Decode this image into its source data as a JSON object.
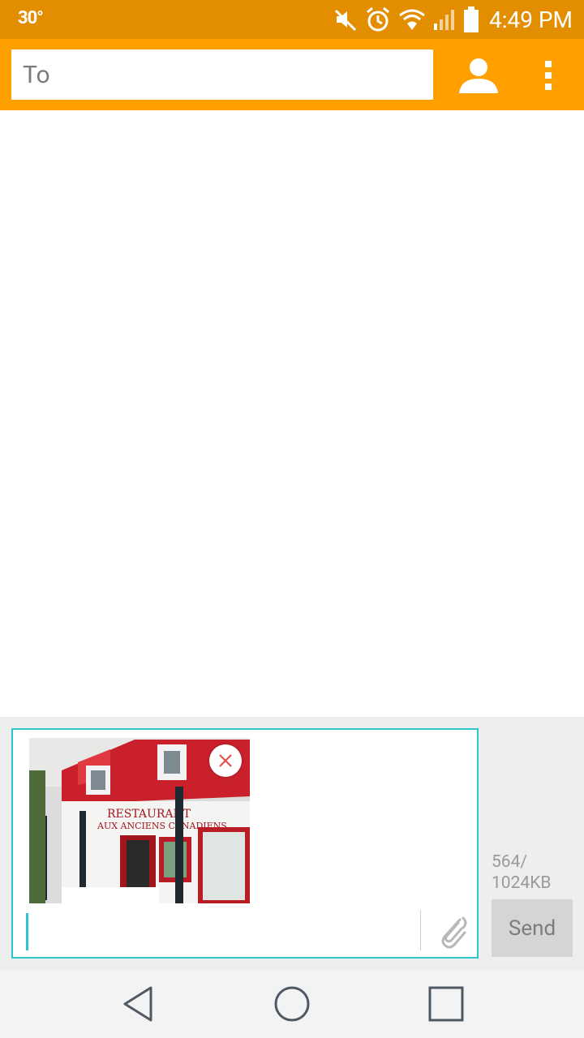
{
  "status_bar": {
    "temperature": "30°",
    "time": "4:49 PM",
    "icons": [
      "mute-icon",
      "alarm-icon",
      "wifi-icon",
      "signal-icon",
      "battery-icon"
    ]
  },
  "header": {
    "to_placeholder": "To",
    "contact_icon": "contact-icon",
    "menu_icon": "overflow-menu-icon"
  },
  "attachment": {
    "description_icon": "photo-thumbnail",
    "remove_icon": "close-icon"
  },
  "composer": {
    "message_value": "",
    "attach_icon": "paperclip-icon",
    "size_used": "564/",
    "size_limit": "1024KB",
    "send_label": "Send"
  },
  "colors": {
    "status_bar": "#e38e00",
    "app_bar": "#ffa000",
    "accent": "#2ec4cc"
  },
  "nav": [
    "back-icon",
    "home-icon",
    "recents-icon"
  ]
}
